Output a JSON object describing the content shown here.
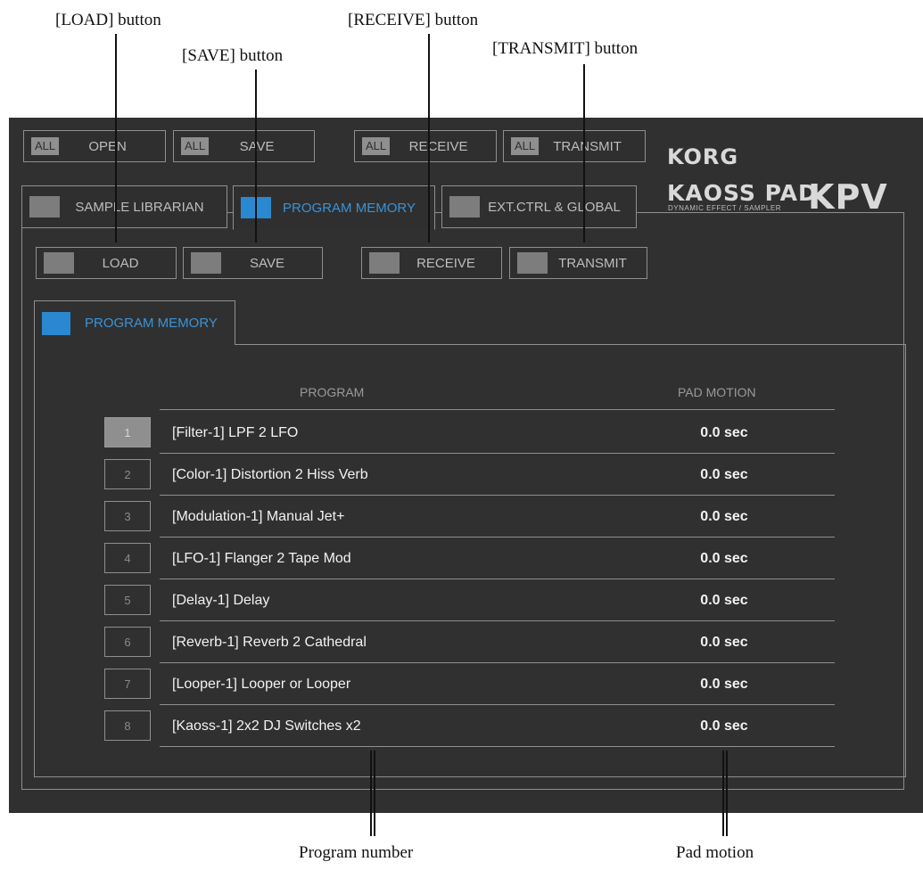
{
  "callouts": {
    "load": "[LOAD] button",
    "save": "[SAVE] button",
    "receive": "[RECEIVE] button",
    "transmit": "[TRANSMIT] button",
    "program_number": "Program number",
    "pad_motion": "Pad motion"
  },
  "toolbar": {
    "all_tag": "ALL",
    "open": "OPEN",
    "save": "SAVE",
    "receive": "RECEIVE",
    "transmit": "TRANSMIT"
  },
  "logo": {
    "korg": "KORG",
    "kaoss": "KAOSS PAD",
    "sub": "DYNAMIC EFFECT / SAMPLER",
    "kpv": "KPV"
  },
  "tabs": {
    "sample_librarian": "SAMPLE LIBRARIAN",
    "program_memory": "PROGRAM MEMORY",
    "ext_ctrl": "EXT.CTRL & GLOBAL"
  },
  "subtoolbar": {
    "load": "LOAD",
    "save": "SAVE",
    "receive": "RECEIVE",
    "transmit": "TRANSMIT"
  },
  "panel": {
    "tab_label": "PROGRAM MEMORY",
    "col_program": "PROGRAM",
    "col_pad_motion": "PAD MOTION"
  },
  "programs": [
    {
      "num": "1",
      "name": "[Filter-1] LPF 2 LFO",
      "motion": "0.0 sec"
    },
    {
      "num": "2",
      "name": "[Color-1] Distortion 2 Hiss Verb",
      "motion": "0.0 sec"
    },
    {
      "num": "3",
      "name": "[Modulation-1] Manual Jet+",
      "motion": "0.0 sec"
    },
    {
      "num": "4",
      "name": "[LFO-1] Flanger 2 Tape Mod",
      "motion": "0.0 sec"
    },
    {
      "num": "5",
      "name": "[Delay-1] Delay",
      "motion": "0.0 sec"
    },
    {
      "num": "6",
      "name": "[Reverb-1] Reverb 2 Cathedral",
      "motion": "0.0 sec"
    },
    {
      "num": "7",
      "name": "[Looper-1] Looper or Looper",
      "motion": "0.0 sec"
    },
    {
      "num": "8",
      "name": "[Kaoss-1] 2x2 DJ Switches x2",
      "motion": "0.0 sec"
    }
  ],
  "colors": {
    "background": "#303030",
    "accent": "#2a88d0",
    "border": "#8f8f8f"
  }
}
